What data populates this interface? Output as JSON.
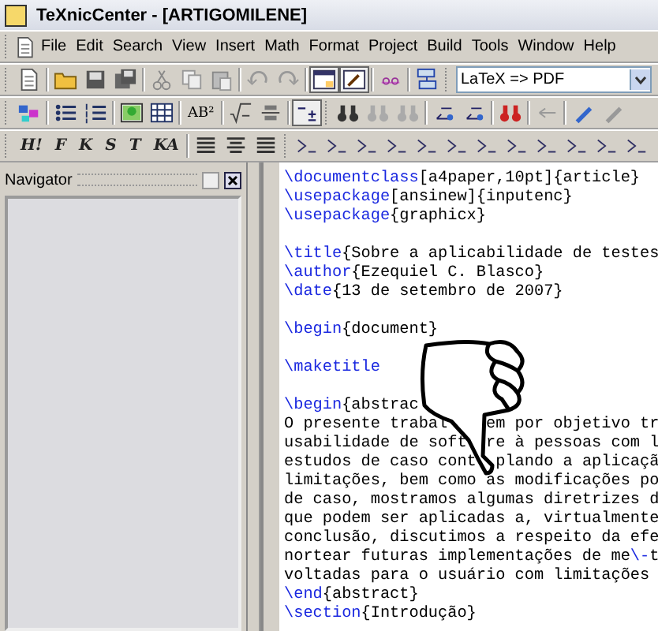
{
  "window": {
    "title": "TeXnicCenter - [ARTIGOMILENE]"
  },
  "menu": [
    "File",
    "Edit",
    "Search",
    "View",
    "Insert",
    "Math",
    "Format",
    "Project",
    "Build",
    "Tools",
    "Window",
    "Help"
  ],
  "toolbar": {
    "output_profile": "LaTeX => PDF",
    "format_buttons": [
      "H!",
      "F",
      "K",
      "S",
      "T",
      "KA"
    ],
    "superscript_button": "AB²"
  },
  "navigator": {
    "title": "Navigator"
  },
  "editor": {
    "lines": [
      {
        "kind": "code",
        "segments": [
          {
            "kind": "command",
            "text": "\\documentclass"
          },
          {
            "kind": "text",
            "text": "[a4paper,10pt]{article}"
          }
        ]
      },
      {
        "kind": "code",
        "segments": [
          {
            "kind": "command",
            "text": "\\usepackage"
          },
          {
            "kind": "text",
            "text": "[ansinew]{inputenc}"
          }
        ]
      },
      {
        "kind": "code",
        "segments": [
          {
            "kind": "command",
            "text": "\\usepackage"
          },
          {
            "kind": "text",
            "text": "{graphicx}"
          }
        ]
      },
      {
        "kind": "blank"
      },
      {
        "kind": "code",
        "segments": [
          {
            "kind": "command",
            "text": "\\title"
          },
          {
            "kind": "text",
            "text": "{Sobre a aplicabilidade de testes"
          }
        ]
      },
      {
        "kind": "code",
        "segments": [
          {
            "kind": "command",
            "text": "\\author"
          },
          {
            "kind": "text",
            "text": "{Ezequiel C. Blasco}"
          }
        ]
      },
      {
        "kind": "code",
        "segments": [
          {
            "kind": "command",
            "text": "\\date"
          },
          {
            "kind": "text",
            "text": "{13 de setembro de 2007}"
          }
        ]
      },
      {
        "kind": "blank"
      },
      {
        "kind": "code",
        "segments": [
          {
            "kind": "command",
            "text": "\\begin"
          },
          {
            "kind": "text",
            "text": "{document}"
          }
        ]
      },
      {
        "kind": "blank"
      },
      {
        "kind": "code",
        "segments": [
          {
            "kind": "command",
            "text": "\\maketitle"
          }
        ]
      },
      {
        "kind": "blank"
      },
      {
        "kind": "code",
        "segments": [
          {
            "kind": "command",
            "text": "\\begin"
          },
          {
            "kind": "text",
            "text": "{abstrac"
          }
        ]
      },
      {
        "kind": "code",
        "segments": [
          {
            "kind": "text",
            "text": "O presente trabal"
          },
          {
            "kind": "text",
            "text": "em por objetivo tr"
          }
        ]
      },
      {
        "kind": "code",
        "segments": [
          {
            "kind": "text",
            "text": "usabilidade de soft"
          },
          {
            "kind": "text",
            "text": "re à pessoas com l"
          }
        ]
      },
      {
        "kind": "code",
        "segments": [
          {
            "kind": "text",
            "text": "estudos de caso cont"
          },
          {
            "kind": "text",
            "text": "plando a aplicaçã"
          }
        ]
      },
      {
        "kind": "code",
        "segments": [
          {
            "kind": "text",
            "text": "limitações, bem como as modificações po"
          }
        ]
      },
      {
        "kind": "code",
        "segments": [
          {
            "kind": "text",
            "text": "de caso, mostramos algumas diretrizes d"
          }
        ]
      },
      {
        "kind": "code",
        "segments": [
          {
            "kind": "text",
            "text": "que podem ser aplicadas a, virtualmente"
          }
        ]
      },
      {
        "kind": "code",
        "segments": [
          {
            "kind": "text",
            "text": "conclusão, discutimos a respeito da efe"
          }
        ]
      },
      {
        "kind": "code",
        "segments": [
          {
            "kind": "text",
            "text": "nortear futuras implementações de me"
          },
          {
            "kind": "command",
            "text": "\\-"
          },
          {
            "kind": "text",
            "text": "t"
          }
        ]
      },
      {
        "kind": "code",
        "segments": [
          {
            "kind": "text",
            "text": "voltadas para o usuário com limitações"
          }
        ]
      },
      {
        "kind": "code",
        "segments": [
          {
            "kind": "command",
            "text": "\\end"
          },
          {
            "kind": "text",
            "text": "{abstract}"
          }
        ]
      },
      {
        "kind": "code",
        "segments": [
          {
            "kind": "command",
            "text": "\\section"
          },
          {
            "kind": "text",
            "text": "{Introdução}"
          }
        ]
      }
    ]
  }
}
